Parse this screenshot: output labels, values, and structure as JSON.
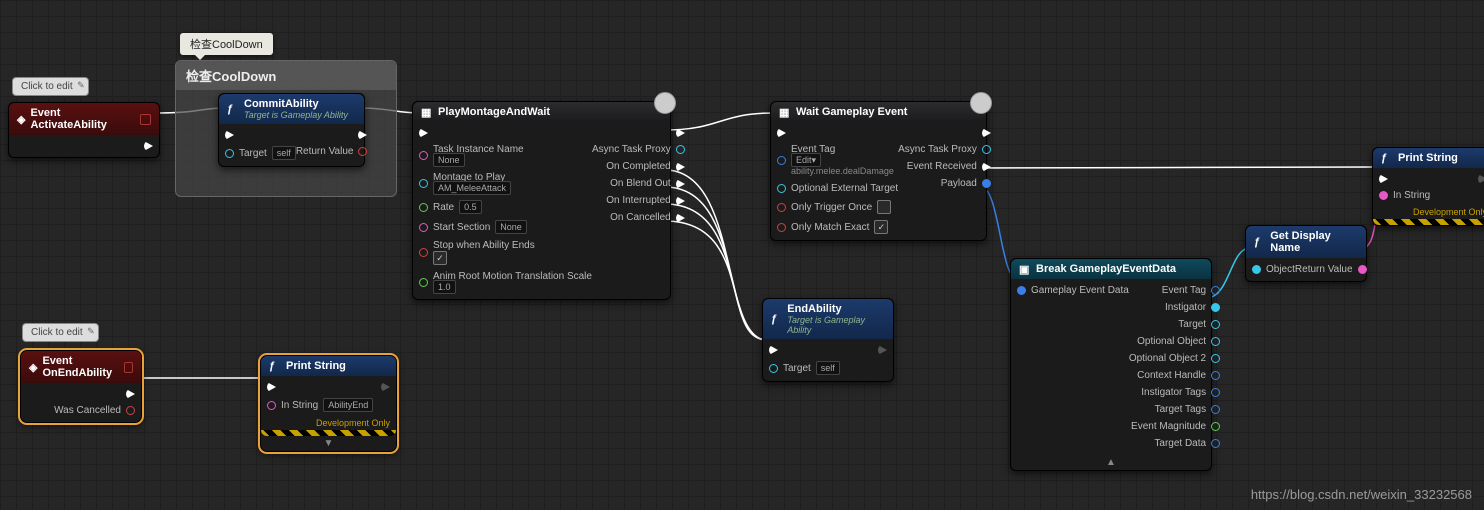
{
  "tooltips": {
    "edit1": "Click to edit",
    "edit2": "Click to edit",
    "collapse": "检查CoolDown"
  },
  "collapse": {
    "title": "检查CoolDown"
  },
  "nodes": {
    "activate": {
      "title": "Event ActivateAbility"
    },
    "onend": {
      "title": "Event OnEndAbility",
      "pin_wascancelled": "Was Cancelled"
    },
    "commit": {
      "title": "CommitAbility",
      "sub": "Target is Gameplay Ability",
      "target": "Target",
      "self": "self",
      "ret": "Return Value"
    },
    "montage": {
      "title": "PlayMontageAndWait",
      "taskname": "Task Instance Name",
      "taskname_val": "None",
      "montage": "Montage to Play",
      "montage_val": "AM_MeleeAttack",
      "rate": "Rate",
      "rate_val": "0.5",
      "section": "Start Section",
      "section_val": "None",
      "stop": "Stop when Ability Ends",
      "anim": "Anim Root Motion Translation Scale",
      "anim_val": "1.0",
      "proxy": "Async Task Proxy",
      "oncomp": "On Completed",
      "onblend": "On Blend Out",
      "onint": "On Interrupted",
      "oncancel": "On Cancelled"
    },
    "waitevent": {
      "title": "Wait Gameplay Event",
      "tag": "Event Tag",
      "edit": "Edit",
      "tagval": "ability.melee.dealDamage",
      "optext": "Optional External Target",
      "once": "Only Trigger Once",
      "exact": "Only Match Exact",
      "proxy": "Async Task Proxy",
      "received": "Event Received",
      "payload": "Payload"
    },
    "endability": {
      "title": "EndAbility",
      "sub": "Target is Gameplay Ability",
      "target": "Target",
      "self": "self"
    },
    "break": {
      "title": "Break GameplayEventData",
      "in": "Gameplay Event Data",
      "o1": "Event Tag",
      "o2": "Instigator",
      "o3": "Target",
      "o4": "Optional Object",
      "o5": "Optional Object 2",
      "o6": "Context Handle",
      "o7": "Instigator Tags",
      "o8": "Target Tags",
      "o9": "Event Magnitude",
      "o10": "Target Data"
    },
    "getdisplay": {
      "title": "Get Display Name",
      "obj": "Object",
      "ret": "Return Value"
    },
    "print1": {
      "title": "Print String",
      "instr": "In String",
      "instr_val": "AbilityEnd",
      "dev": "Development Only"
    },
    "print2": {
      "title": "Print String",
      "instr": "In String",
      "dev": "Development Only"
    }
  },
  "watermark": "https://blog.csdn.net/weixin_33232568"
}
